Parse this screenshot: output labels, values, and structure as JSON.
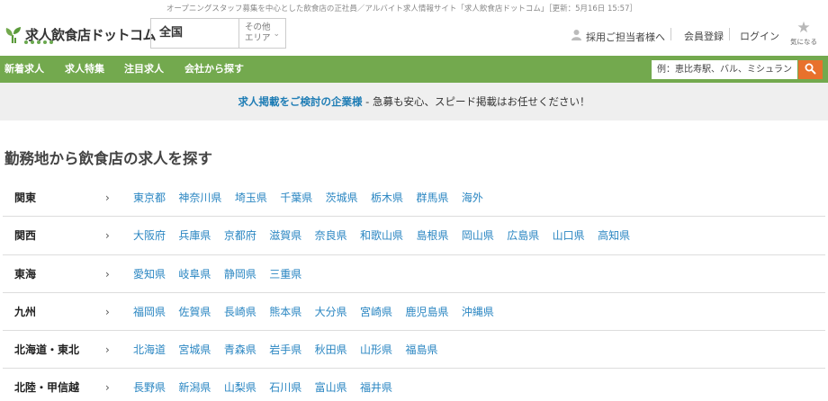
{
  "header": {
    "tagline": "オープニングスタッフ募集を中心とした飲食店の正社員／アルバイト求人情報サイト「求人飲食店ドットコム」［更新：5月16日 15:57］",
    "logo_text": "求人飲食店ドットコム",
    "area_value": "全国",
    "area_other_line1": "その他",
    "area_other_line2": "エリア",
    "employer_link": "採用ご担当者様へ",
    "register_link": "会員登録",
    "login_link": "ログイン",
    "favorites_label": "気になる"
  },
  "menu": {
    "items": [
      {
        "label": "新着求人"
      },
      {
        "label": "求人特集"
      },
      {
        "label": "注目求人"
      },
      {
        "label": "会社から探す"
      }
    ],
    "search_placeholder": "例：恵比寿駅、バル、ミシュラン"
  },
  "banner": {
    "link_text": "求人掲載をご検討の企業様",
    "text": " - 急募も安心、スピード掲載はお任せください！"
  },
  "main": {
    "title": "勤務地から飲食店の求人を探す",
    "regions": [
      {
        "name": "関東",
        "prefectures": [
          "東京都",
          "神奈川県",
          "埼玉県",
          "千葉県",
          "茨城県",
          "栃木県",
          "群馬県",
          "海外"
        ]
      },
      {
        "name": "関西",
        "prefectures": [
          "大阪府",
          "兵庫県",
          "京都府",
          "滋賀県",
          "奈良県",
          "和歌山県",
          "島根県",
          "岡山県",
          "広島県",
          "山口県",
          "高知県"
        ]
      },
      {
        "name": "東海",
        "prefectures": [
          "愛知県",
          "岐阜県",
          "静岡県",
          "三重県"
        ]
      },
      {
        "name": "九州",
        "prefectures": [
          "福岡県",
          "佐賀県",
          "長崎県",
          "熊本県",
          "大分県",
          "宮崎県",
          "鹿児島県",
          "沖縄県"
        ]
      },
      {
        "name": "北海道・東北",
        "prefectures": [
          "北海道",
          "宮城県",
          "青森県",
          "岩手県",
          "秋田県",
          "山形県",
          "福島県"
        ]
      },
      {
        "name": "北陸・甲信越",
        "prefectures": [
          "長野県",
          "新潟県",
          "山梨県",
          "石川県",
          "富山県",
          "福井県"
        ]
      }
    ]
  },
  "colors": {
    "accent_green": "#73a94e",
    "link_blue": "#2a86c2",
    "search_orange": "#e8712c"
  },
  "icons": {
    "logo": "sprout-icon",
    "employer": "person-icon",
    "favorites": "star-icon",
    "search": "search-icon",
    "region_chevron": "chevron-right-icon",
    "area_chevron": "chevron-down-icon"
  }
}
